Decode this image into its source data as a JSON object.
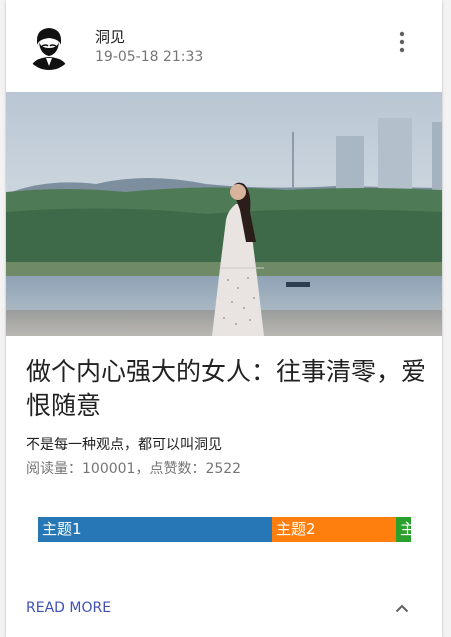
{
  "post": {
    "author": "洞见",
    "date": "19-05-18 21:33",
    "title": "做个内心强大的女人：往事清零，爱恨随意",
    "subtitle": "不是每一种观点，都可以叫洞见",
    "stats": "阅读量：100001，点赞数：2522"
  },
  "tags": [
    {
      "label": "主题1",
      "color": "#2777b6"
    },
    {
      "label": "主题2",
      "color": "#ff7f0e"
    },
    {
      "label": "主",
      "color": "#2ca02c"
    }
  ],
  "actions": {
    "read_more": "READ MORE",
    "more_icon": "more-vert-icon",
    "expand_icon": "chevron-up-icon"
  },
  "colors": {
    "accent": "#3f51b5"
  }
}
